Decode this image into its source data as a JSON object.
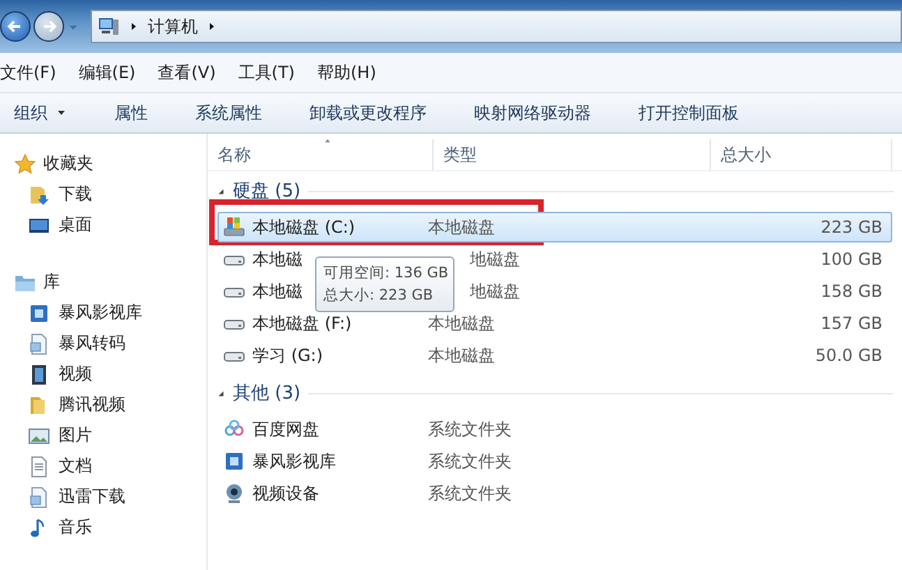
{
  "address_bar": {
    "path": [
      "计算机"
    ]
  },
  "menu_bar": [
    "文件(F)",
    "编辑(E)",
    "查看(V)",
    "工具(T)",
    "帮助(H)"
  ],
  "toolbar": [
    {
      "label": "组织",
      "kind": "dropdown"
    },
    {
      "label": "属性",
      "kind": "button"
    },
    {
      "label": "系统属性",
      "kind": "button"
    },
    {
      "label": "卸载或更改程序",
      "kind": "button"
    },
    {
      "label": "映射网络驱动器",
      "kind": "button"
    },
    {
      "label": "打开控制面板",
      "kind": "button"
    }
  ],
  "sidebar": {
    "sections": [
      {
        "label": "收藏夹",
        "kind": "star",
        "items": [
          {
            "label": "下载",
            "kind": "download"
          },
          {
            "label": "桌面",
            "kind": "desktop"
          }
        ]
      },
      {
        "label": "库",
        "kind": "library",
        "items": [
          {
            "label": "暴风影视库",
            "kind": "media"
          },
          {
            "label": "暴风转码",
            "kind": "doc"
          },
          {
            "label": "视频",
            "kind": "video"
          },
          {
            "label": "腾讯视频",
            "kind": "folder"
          },
          {
            "label": "图片",
            "kind": "image"
          },
          {
            "label": "文档",
            "kind": "text"
          },
          {
            "label": "迅雷下载",
            "kind": "doc"
          },
          {
            "label": "音乐",
            "kind": "music"
          }
        ]
      }
    ]
  },
  "table": {
    "columns": [
      "名称",
      "类型",
      "总大小"
    ],
    "groups": [
      {
        "label": "硬盘 (5)",
        "expanded": true,
        "rows": [
          {
            "name": "本地磁盘 (C:)",
            "type": "本地磁盘",
            "size": "223 GB",
            "kind": "system-drive",
            "selected": true,
            "annotated": true
          },
          {
            "name": "本地磁",
            "type": "地磁盘",
            "size": "100 GB",
            "kind": "drive",
            "selected": false,
            "under_tooltip": true
          },
          {
            "name": "本地磁",
            "type": "地磁盘",
            "size": "158 GB",
            "kind": "drive",
            "selected": false,
            "under_tooltip": true
          },
          {
            "name": "本地磁盘 (F:)",
            "type": "本地磁盘",
            "size": "157 GB",
            "kind": "drive",
            "selected": false
          },
          {
            "name": "学习 (G:)",
            "type": "本地磁盘",
            "size": "50.0 GB",
            "kind": "drive",
            "selected": false
          }
        ]
      },
      {
        "label": "其他 (3)",
        "expanded": true,
        "rows": [
          {
            "name": "百度网盘",
            "type": "系统文件夹",
            "kind": "cloud",
            "selected": false
          },
          {
            "name": "暴风影视库",
            "type": "系统文件夹",
            "kind": "media",
            "selected": false
          },
          {
            "name": "视频设备",
            "type": "系统文件夹",
            "kind": "webcam",
            "selected": false
          }
        ]
      }
    ]
  },
  "tooltip": {
    "lines": [
      "可用空间: 136 GB",
      "总大小: 223 GB"
    ]
  }
}
